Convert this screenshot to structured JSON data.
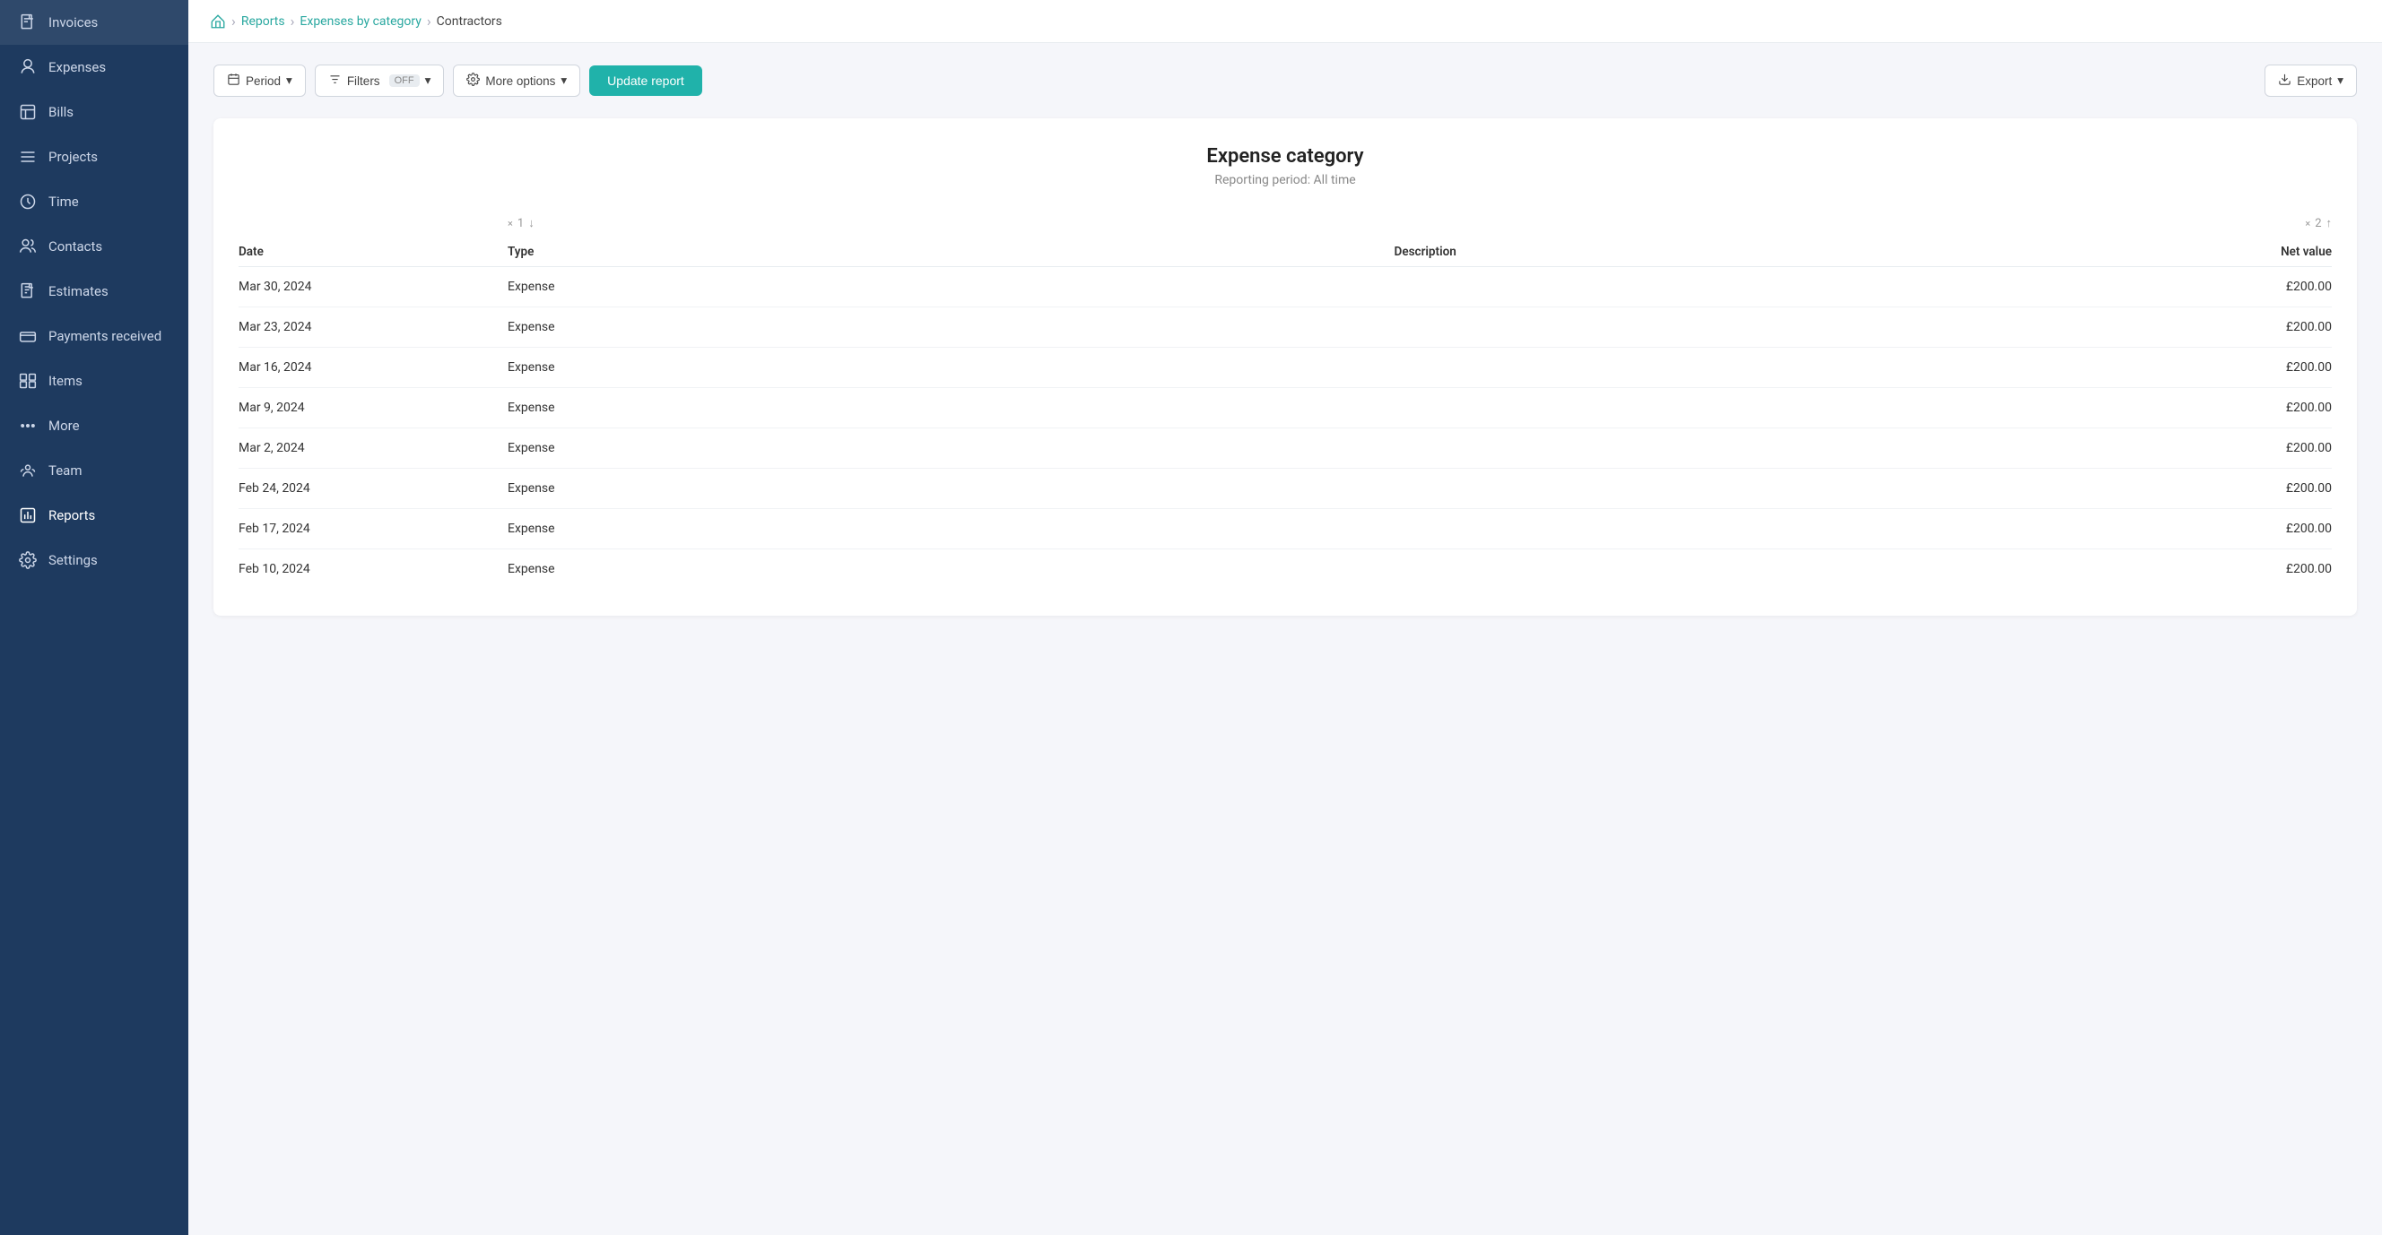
{
  "sidebar": {
    "items": [
      {
        "id": "invoices",
        "label": "Invoices",
        "icon": "invoice"
      },
      {
        "id": "expenses",
        "label": "Expenses",
        "icon": "expenses"
      },
      {
        "id": "bills",
        "label": "Bills",
        "icon": "bills"
      },
      {
        "id": "projects",
        "label": "Projects",
        "icon": "projects"
      },
      {
        "id": "time",
        "label": "Time",
        "icon": "time"
      },
      {
        "id": "contacts",
        "label": "Contacts",
        "icon": "contacts"
      },
      {
        "id": "estimates",
        "label": "Estimates",
        "icon": "estimates"
      },
      {
        "id": "payments-received",
        "label": "Payments received",
        "icon": "payments"
      },
      {
        "id": "items",
        "label": "Items",
        "icon": "items"
      },
      {
        "id": "more",
        "label": "More",
        "icon": "more"
      },
      {
        "id": "team",
        "label": "Team",
        "icon": "team"
      },
      {
        "id": "reports",
        "label": "Reports",
        "icon": "reports"
      },
      {
        "id": "settings",
        "label": "Settings",
        "icon": "settings"
      }
    ]
  },
  "breadcrumb": {
    "home": "home",
    "reports": "Reports",
    "expenses_by_category": "Expenses by category",
    "current": "Contractors"
  },
  "toolbar": {
    "period_label": "Period",
    "filters_label": "Filters",
    "filters_status": "OFF",
    "more_options_label": "More options",
    "update_report_label": "Update report",
    "export_label": "Export"
  },
  "report": {
    "title": "Expense category",
    "subtitle": "Reporting period: All time",
    "sort1": "× 1 ↓",
    "sort2": "× 2 ↑",
    "columns": [
      "Date",
      "Type",
      "Description",
      "Net value"
    ],
    "rows": [
      {
        "date": "Mar 30, 2024",
        "type": "Expense",
        "description": "",
        "net_value": "£200.00"
      },
      {
        "date": "Mar 23, 2024",
        "type": "Expense",
        "description": "",
        "net_value": "£200.00"
      },
      {
        "date": "Mar 16, 2024",
        "type": "Expense",
        "description": "",
        "net_value": "£200.00"
      },
      {
        "date": "Mar 9, 2024",
        "type": "Expense",
        "description": "",
        "net_value": "£200.00"
      },
      {
        "date": "Mar 2, 2024",
        "type": "Expense",
        "description": "",
        "net_value": "£200.00"
      },
      {
        "date": "Feb 24, 2024",
        "type": "Expense",
        "description": "",
        "net_value": "£200.00"
      },
      {
        "date": "Feb 17, 2024",
        "type": "Expense",
        "description": "",
        "net_value": "£200.00"
      },
      {
        "date": "Feb 10, 2024",
        "type": "Expense",
        "description": "",
        "net_value": "£200.00"
      }
    ]
  }
}
